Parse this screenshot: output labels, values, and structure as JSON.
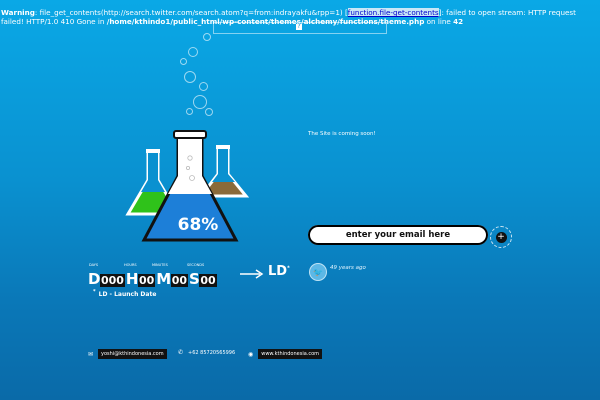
{
  "warning": {
    "label": "Warning",
    "text_1": ": file_get_contents(http://search.twitter.com/search.atom?q=from:indrayakfu&rpp=1) [",
    "link": "function.file-get-contents",
    "text_2": "]: failed to open stream: HTTP request failed! HTTP/1.0 410 Gone in ",
    "path": "/home/kthindo1/public_html/wp-content/themes/alchemy/functions/theme.php",
    "text_3": " on line ",
    "line": "42"
  },
  "flasks": {
    "percent": "68%",
    "progress": 0.68
  },
  "tagline": "The Site is coming soon!",
  "email": {
    "placeholder": "enter your email here",
    "submit_icon": "plus-icon"
  },
  "twitter": {
    "icon": "twitter-bird-icon",
    "time": "49 years ago"
  },
  "countdown": {
    "labels": [
      "DAYS",
      "HOURS",
      "MINUTES",
      "SECONDS"
    ],
    "units": [
      {
        "letter": "D",
        "value": "000"
      },
      {
        "letter": "H",
        "value": "00"
      },
      {
        "letter": "M",
        "value": "00"
      },
      {
        "letter": "S",
        "value": "00"
      }
    ],
    "target": "LD",
    "target_mark": "*",
    "caption_mark": "*",
    "caption": "LD - Launch Date"
  },
  "footer": {
    "email_icon": "mail-icon",
    "email": "yoshi@kthindonesia.com",
    "phone_icon": "phone-icon",
    "phone": "+62 85720565996",
    "web_icon": "globe-icon",
    "website": "www.kthindonesia.com"
  },
  "colors": {
    "background_top": "#0aa8e6",
    "background_bottom": "#0a6aa8",
    "liquid_green": "#2fc21a",
    "liquid_brown": "#8a6a3a",
    "liquid_blue": "#1d7fd8"
  }
}
